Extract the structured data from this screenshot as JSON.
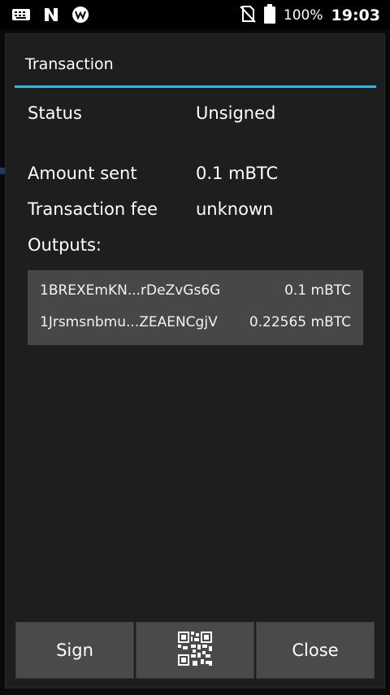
{
  "status_bar": {
    "battery": "100%",
    "time": "19:03"
  },
  "dialog": {
    "title": "Transaction",
    "rows": [
      {
        "label": "Status",
        "value": "Unsigned"
      },
      {
        "label": "Amount sent",
        "value": "0.1 mBTC"
      },
      {
        "label": "Transaction fee",
        "value": "unknown"
      }
    ],
    "outputs_label": "Outputs:",
    "outputs": [
      {
        "address": "1BREXEmKN...rDeZvGs6G",
        "amount": "0.1 mBTC"
      },
      {
        "address": "1Jrsmsnbmu...ZEAENCgjV",
        "amount": "0.22565 mBTC"
      }
    ],
    "buttons": {
      "sign": "Sign",
      "qr_icon": "qr-code-icon",
      "close": "Close"
    }
  },
  "colors": {
    "accent": "#33b5e5",
    "dialog_bg": "#1e1e1e",
    "outputs_bg": "#474747",
    "button_bg": "#4a4a4a"
  }
}
